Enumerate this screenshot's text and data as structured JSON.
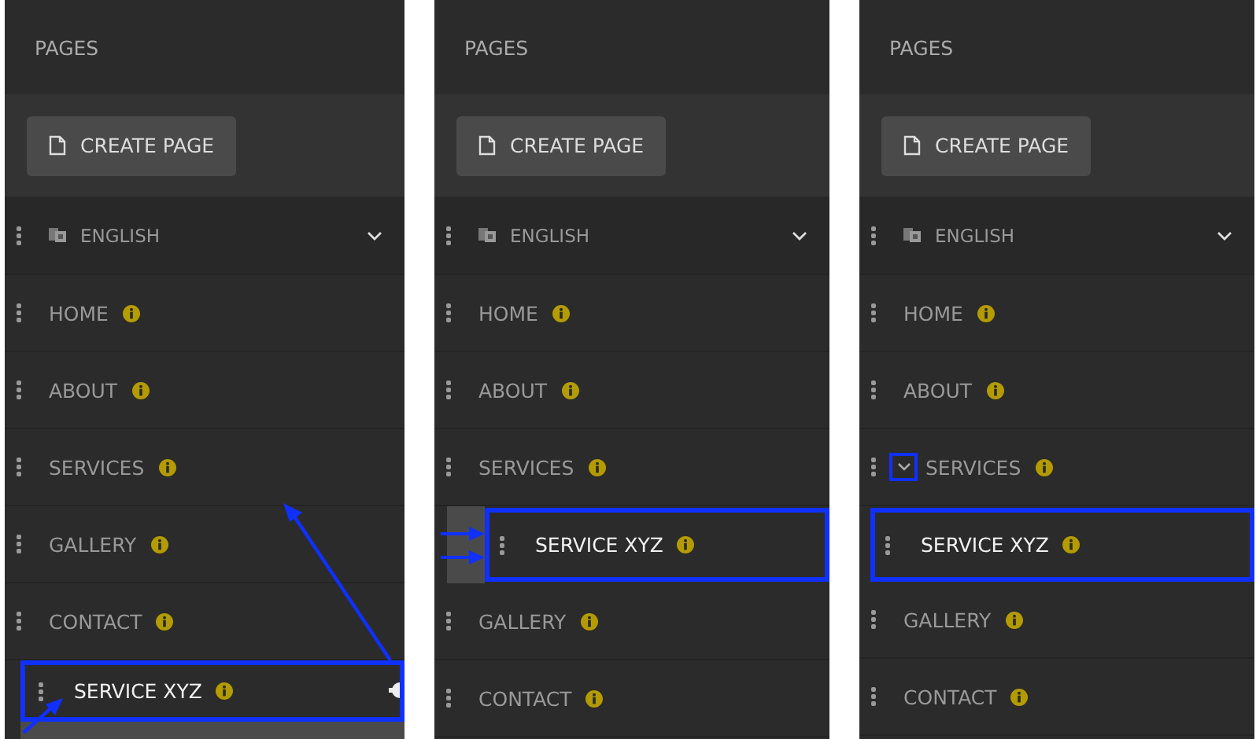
{
  "panels": [
    {
      "title": "PAGES",
      "create_button": "CREATE PAGE",
      "language": {
        "label": "ENGLISH"
      },
      "pages": [
        {
          "label": "HOME",
          "expanded": false
        },
        {
          "label": "ABOUT",
          "expanded": false
        },
        {
          "label": "SERVICES",
          "expanded": false
        },
        {
          "label": "GALLERY",
          "expanded": false
        },
        {
          "label": "CONTACT",
          "expanded": false
        }
      ],
      "dragged_item": {
        "label": "SERVICE XYZ",
        "highlighted": true
      }
    },
    {
      "title": "PAGES",
      "create_button": "CREATE PAGE",
      "language": {
        "label": "ENGLISH"
      },
      "pages": [
        {
          "label": "HOME",
          "expanded": false
        },
        {
          "label": "ABOUT",
          "expanded": false
        },
        {
          "label": "SERVICES",
          "expanded": false,
          "children": [
            {
              "kind": "drop-target",
              "label": "SERVICE XYZ",
              "highlighted": true
            }
          ]
        },
        {
          "label": "GALLERY",
          "expanded": false
        },
        {
          "label": "CONTACT",
          "expanded": false
        }
      ]
    },
    {
      "title": "PAGES",
      "create_button": "CREATE PAGE",
      "language": {
        "label": "ENGLISH"
      },
      "pages": [
        {
          "label": "HOME",
          "expanded": false
        },
        {
          "label": "ABOUT",
          "expanded": false
        },
        {
          "label": "SERVICES",
          "expanded": true,
          "children": [
            {
              "kind": "child",
              "label": "SERVICE XYZ",
              "highlighted": true
            }
          ]
        },
        {
          "label": "GALLERY",
          "expanded": false
        },
        {
          "label": "CONTACT",
          "expanded": false
        }
      ]
    }
  ]
}
